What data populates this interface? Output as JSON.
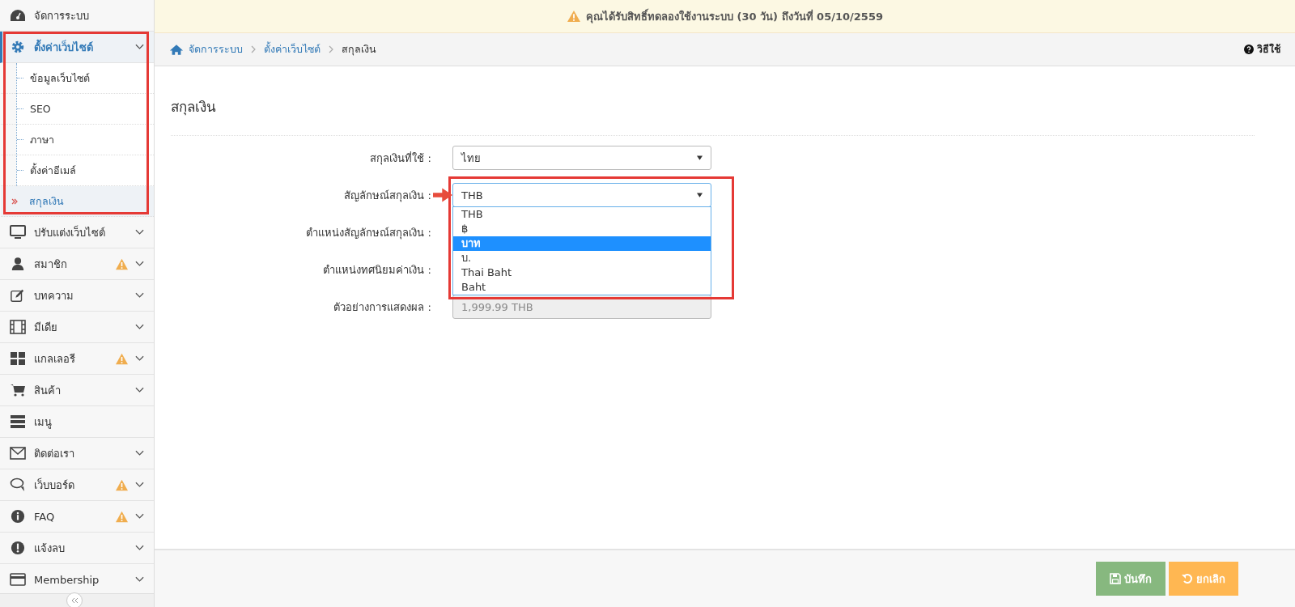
{
  "sidebar": {
    "items": [
      {
        "label": "จัดการระบบ",
        "expandable": false,
        "expanded": false,
        "warning": false
      },
      {
        "label": "ตั้งค่าเว็บไซต์",
        "expandable": true,
        "expanded": true,
        "warning": false,
        "children": [
          {
            "label": "ข้อมูลเว็บไซต์",
            "selected": false
          },
          {
            "label": "SEO",
            "selected": false
          },
          {
            "label": "ภาษา",
            "selected": false
          },
          {
            "label": "ตั้งค่าอีเมล์",
            "selected": false
          },
          {
            "label": "สกุลเงิน",
            "selected": true
          }
        ]
      },
      {
        "label": "ปรับแต่งเว็บไซต์",
        "expandable": true,
        "expanded": false,
        "warning": false
      },
      {
        "label": "สมาชิก",
        "expandable": true,
        "expanded": false,
        "warning": true
      },
      {
        "label": "บทความ",
        "expandable": true,
        "expanded": false,
        "warning": false
      },
      {
        "label": "มีเดีย",
        "expandable": true,
        "expanded": false,
        "warning": false
      },
      {
        "label": "แกลเลอรี",
        "expandable": true,
        "expanded": false,
        "warning": true
      },
      {
        "label": "สินค้า",
        "expandable": true,
        "expanded": false,
        "warning": false
      },
      {
        "label": "เมนู",
        "expandable": false,
        "expanded": false,
        "warning": false
      },
      {
        "label": "ติดต่อเรา",
        "expandable": true,
        "expanded": false,
        "warning": false
      },
      {
        "label": "เว็บบอร์ด",
        "expandable": true,
        "expanded": false,
        "warning": true
      },
      {
        "label": "FAQ",
        "expandable": true,
        "expanded": false,
        "warning": true
      },
      {
        "label": "แจ้งลบ",
        "expandable": true,
        "expanded": false,
        "warning": false
      },
      {
        "label": "Membership",
        "expandable": true,
        "expanded": false,
        "warning": false
      }
    ]
  },
  "notice": "คุณได้รับสิทธิ์ทดลองใช้งานระบบ (30 วัน) ถึงวันที่ 05/10/2559",
  "breadcrumb": [
    "จัดการระบบ",
    "ตั้งค่าเว็บไซต์",
    "สกุลเงิน"
  ],
  "help": "วิธีใช้",
  "page_title": "สกุลเงิน",
  "form": [
    {
      "kind": "select",
      "label": "สกุลเงินที่ใช้ :",
      "value": "ไทย"
    },
    {
      "kind": "select",
      "label": "สัญลักษณ์สกุลเงิน :",
      "value": "THB",
      "open": true,
      "options": [
        {
          "label": "THB",
          "highlighted": false
        },
        {
          "label": "฿",
          "highlighted": false
        },
        {
          "label": "บาท",
          "highlighted": true
        },
        {
          "label": "บ.",
          "highlighted": false
        },
        {
          "label": "Thai Baht",
          "highlighted": false
        },
        {
          "label": "Baht",
          "highlighted": false
        }
      ]
    },
    {
      "kind": "hidden",
      "label": "ตำแหน่งสัญลักษณ์สกุลเงิน :"
    },
    {
      "kind": "hidden",
      "label": "ตำแหน่งทศนิยมค่าเงิน :"
    },
    {
      "kind": "readonly",
      "label": "ตัวอย่างการแสดงผล :",
      "value": "1,999.99 THB"
    }
  ],
  "buttons": [
    {
      "kind": "save",
      "label": "บันทึก"
    },
    {
      "kind": "cancel",
      "label": "ยกเลิก"
    }
  ]
}
